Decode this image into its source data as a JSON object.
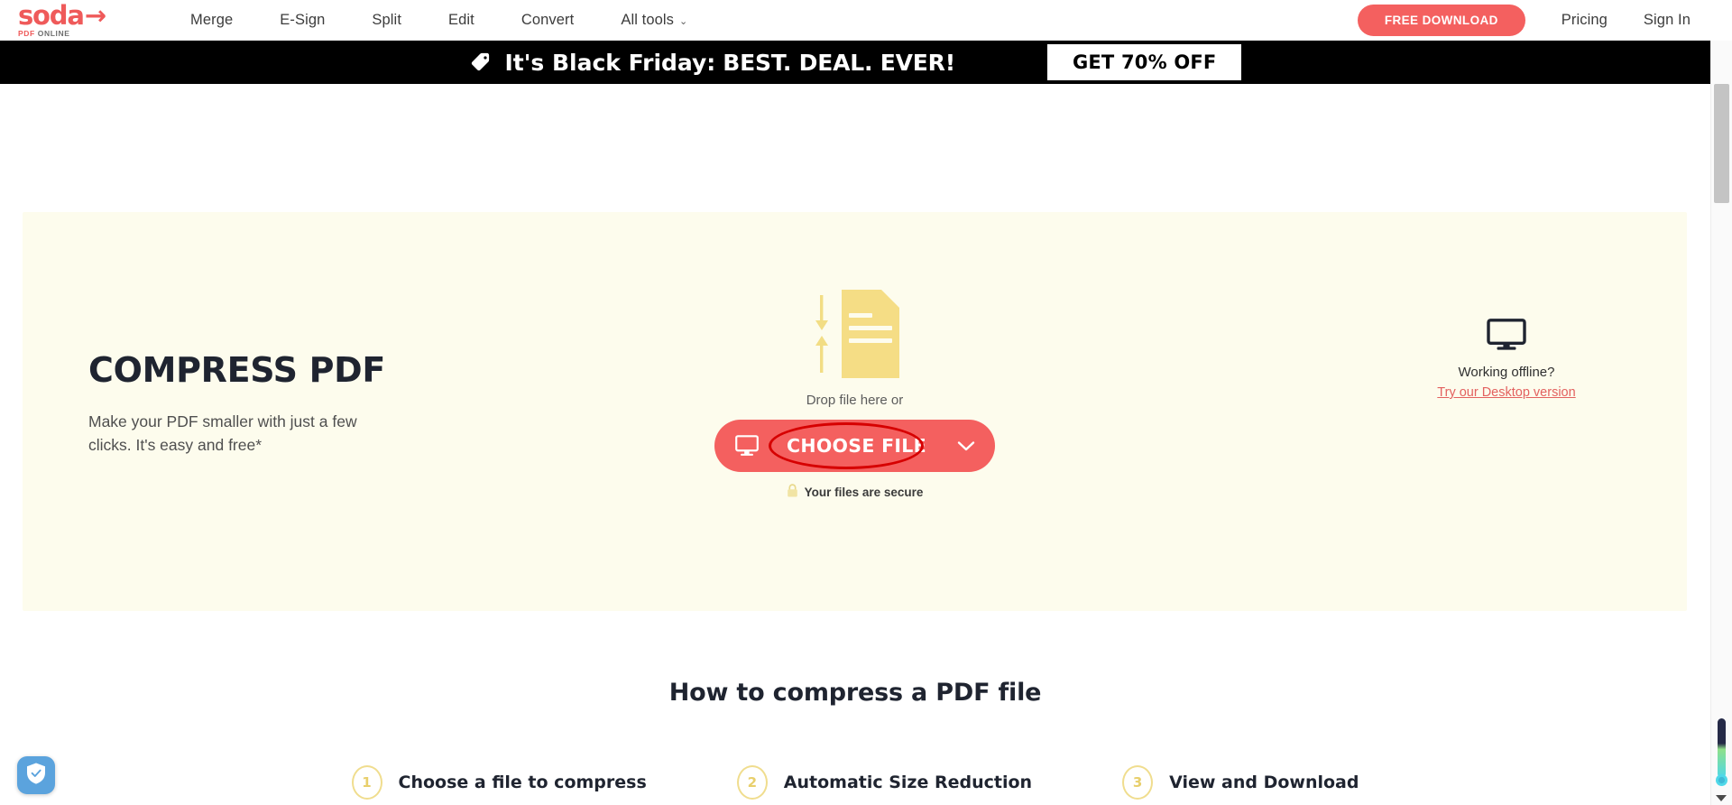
{
  "brand": {
    "logo_text": "soda",
    "logo_arrow": "→",
    "logo_sub_pdf": "PDF",
    "logo_sub_online": "ONLINE",
    "accent_color": "#f4605f",
    "banner_bg": "#000000",
    "hero_bg": "#fdfced",
    "step_circle_color": "#f0dd8e",
    "annotation_color": "#d60000"
  },
  "nav": {
    "links": [
      {
        "label": "Merge"
      },
      {
        "label": "E-Sign"
      },
      {
        "label": "Split"
      },
      {
        "label": "Edit"
      },
      {
        "label": "Convert"
      },
      {
        "label": "All tools",
        "caret": "⌄"
      }
    ],
    "free_download": "FREE DOWNLOAD",
    "pricing": "Pricing",
    "sign_in": "Sign In"
  },
  "banner": {
    "lead": "It's Black Friday:",
    "emphasis": "BEST. DEAL. EVER!",
    "cta": "GET 70% OFF"
  },
  "hero": {
    "title": "COMPRESS PDF",
    "subtitle": "Make your PDF smaller with just a few clicks. It's easy and free*",
    "drop_label": "Drop file here or",
    "choose_file": "CHOOSE FILE",
    "secure_text": "Your files are secure",
    "offline_label": "Working offline?",
    "offline_link": "Try our Desktop version"
  },
  "howto": {
    "title": "How to compress a PDF file",
    "steps": [
      {
        "num": "1",
        "label": "Choose a file to compress"
      },
      {
        "num": "2",
        "label": "Automatic Size Reduction"
      },
      {
        "num": "3",
        "label": "View and Download"
      }
    ]
  }
}
